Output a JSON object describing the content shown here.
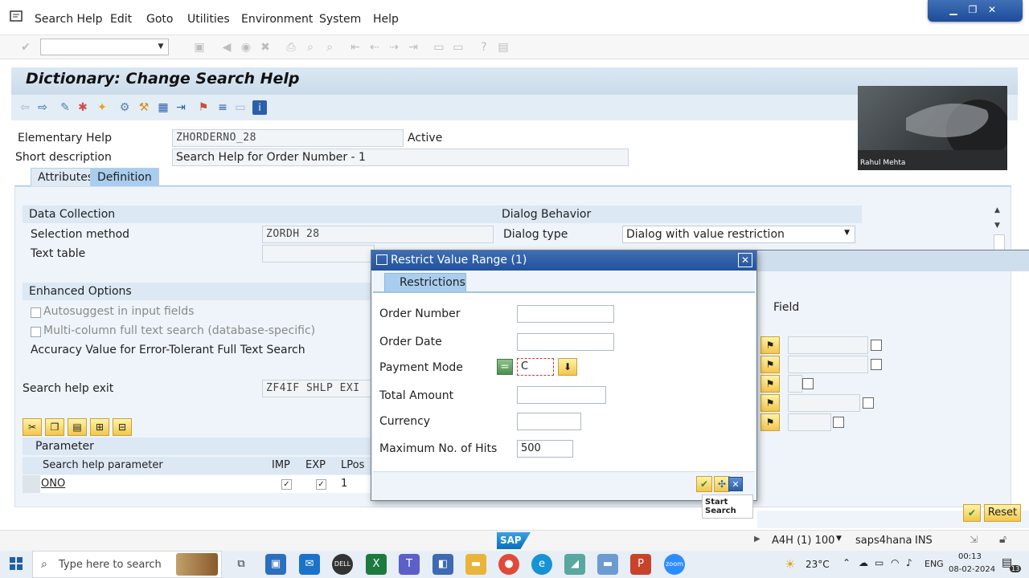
{
  "menubar": {
    "items": [
      "Search Help",
      "Edit",
      "Goto",
      "Utilities",
      "Environment",
      "System",
      "Help"
    ]
  },
  "title": "Dictionary: Change Search Help",
  "header": {
    "elementary_help_label": "Elementary Help",
    "elementary_help_value": "ZHORDERNO_28",
    "status": "Active",
    "short_desc_label": "Short description",
    "short_desc_value": "Search Help for Order Number - 1"
  },
  "tabs": [
    "Attributes",
    "Definition"
  ],
  "data_collection": {
    "heading": "Data Collection",
    "selection_method_label": "Selection method",
    "selection_method_value": "ZORDH 28",
    "text_table_label": "Text table"
  },
  "dialog_behavior": {
    "heading": "Dialog Behavior",
    "dialog_type_label": "Dialog type",
    "dialog_type_value": "Dialog with value restriction"
  },
  "enhanced_options": {
    "heading": "Enhanced Options",
    "autosuggest_label": "Autosuggest in input fields",
    "multicolumn_label": "Multi-column full text search (database-specific)",
    "accuracy_label": "Accuracy Value for Error-Tolerant Full Text Search"
  },
  "search_help_exit": {
    "label": "Search help exit",
    "value": "ZF4IF SHLP EXI"
  },
  "parameter": {
    "heading": "Parameter",
    "columns": [
      "Search help parameter",
      "IMP",
      "EXP",
      "LPos"
    ],
    "rows": [
      {
        "name": "ONO",
        "lpos": "1"
      }
    ],
    "right_column_label": "Field"
  },
  "dialog": {
    "title": "Restrict Value Range (1)",
    "tab": "Restrictions",
    "fields": {
      "order_number": "Order Number",
      "order_date": "Order Date",
      "payment_mode": "Payment Mode",
      "payment_mode_value": "C",
      "total_amount": "Total Amount",
      "currency": "Currency",
      "max_hits": "Maximum No. of Hits",
      "max_hits_value": "500"
    },
    "tooltip": "Start Search"
  },
  "bottom": {
    "reset_label": "Reset"
  },
  "webcam": {
    "name": "Rahul Mehta"
  },
  "statusbar": {
    "system": "A4H (1) 100",
    "server": "saps4hana",
    "mode": "INS",
    "logo": "SAP"
  },
  "taskbar": {
    "search_placeholder": "Type here to search",
    "temperature": "23°C",
    "language": "ENG",
    "time": "00:13",
    "date": "08-02-2024",
    "notifications": "13"
  }
}
